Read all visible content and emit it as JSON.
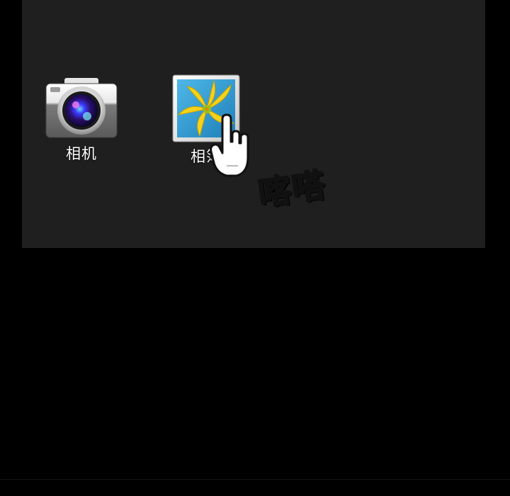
{
  "home_screen": {
    "apps": [
      {
        "label": "相机",
        "icon": "camera-icon"
      },
      {
        "label": "相簿",
        "icon": "photo-album-icon"
      }
    ]
  },
  "cursor": {
    "icon": "hand-pointer-icon"
  },
  "sound_effect": {
    "text": "喀嗒"
  },
  "colors": {
    "background": "#000000",
    "screen": "#1f1f1f",
    "label": "#ffffff"
  }
}
